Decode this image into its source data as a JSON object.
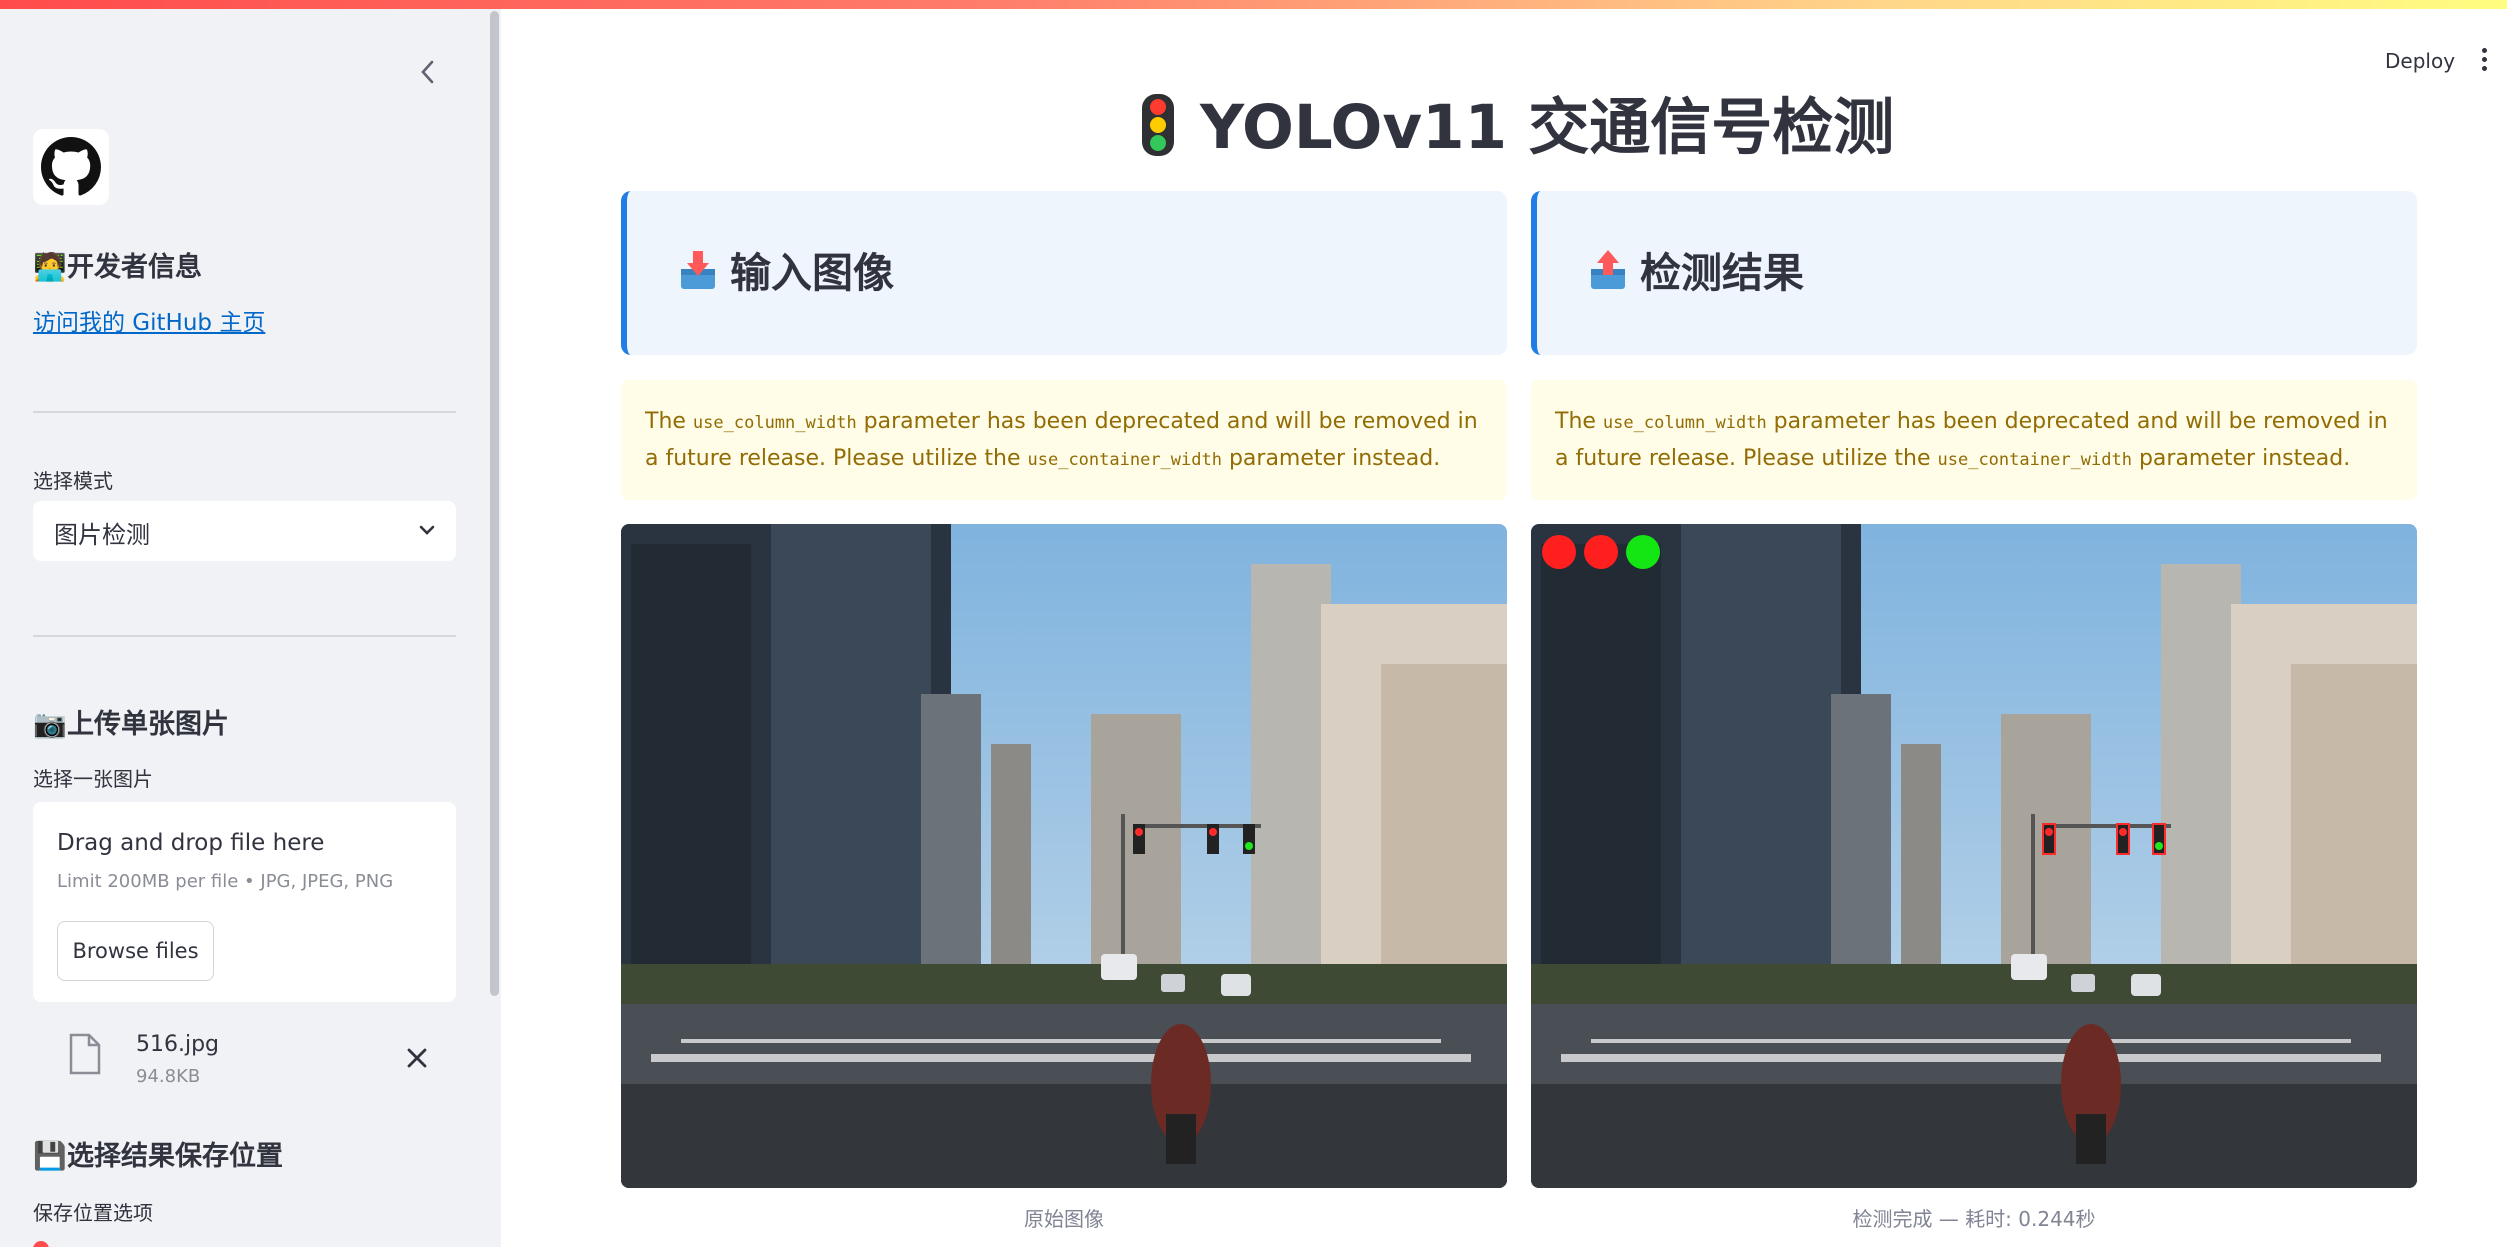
{
  "app": {
    "title": "YOLOv11 交通信号检测",
    "deploy_label": "Deploy"
  },
  "sidebar": {
    "developer_heading": "开发者信息",
    "developer_emoji": "🧑‍💻",
    "github_link": "访问我的 GitHub 主页",
    "mode_label": "选择模式",
    "mode_value": "图片检测",
    "upload_heading": "上传单张图片",
    "upload_emoji": "📷",
    "upload_label": "选择一张图片",
    "dropzone_title": "Drag and drop file here",
    "dropzone_limit": "Limit 200MB per file • JPG, JPEG, PNG",
    "browse_label": "Browse files",
    "file": {
      "name": "516.jpg",
      "size": "94.8KB"
    },
    "save_heading": "选择结果保存位置",
    "save_emoji": "💾",
    "save_label": "保存位置选项"
  },
  "panels": {
    "input": {
      "title": "输入图像",
      "warn_pre": "The ",
      "warn_code1": "use_column_width",
      "warn_mid": " parameter has been deprecated and will be removed in a future release. Please utilize the ",
      "warn_code2": "use_container_width",
      "warn_post": " parameter instead.",
      "caption": "原始图像"
    },
    "output": {
      "title": "检测结果",
      "warn_pre": "The ",
      "warn_code1": "use_column_width",
      "warn_mid": " parameter has been deprecated and will be removed in a future release. Please utilize the ",
      "warn_code2": "use_container_width",
      "warn_post": " parameter instead.",
      "caption": "检测完成 — 耗时: 0.244秒"
    }
  },
  "colors": {
    "accent": "#1f7de4",
    "link": "#0068c9",
    "warning_text": "#926c05",
    "light_red": "#ff2a2a",
    "light_green": "#1fe81f"
  },
  "icons": [
    "traffic-light-icon",
    "chevron-left-icon",
    "github-icon",
    "chevron-down-icon",
    "file-icon",
    "close-icon",
    "more-vert-icon",
    "inbox-tray-icon",
    "outbox-tray-icon"
  ]
}
